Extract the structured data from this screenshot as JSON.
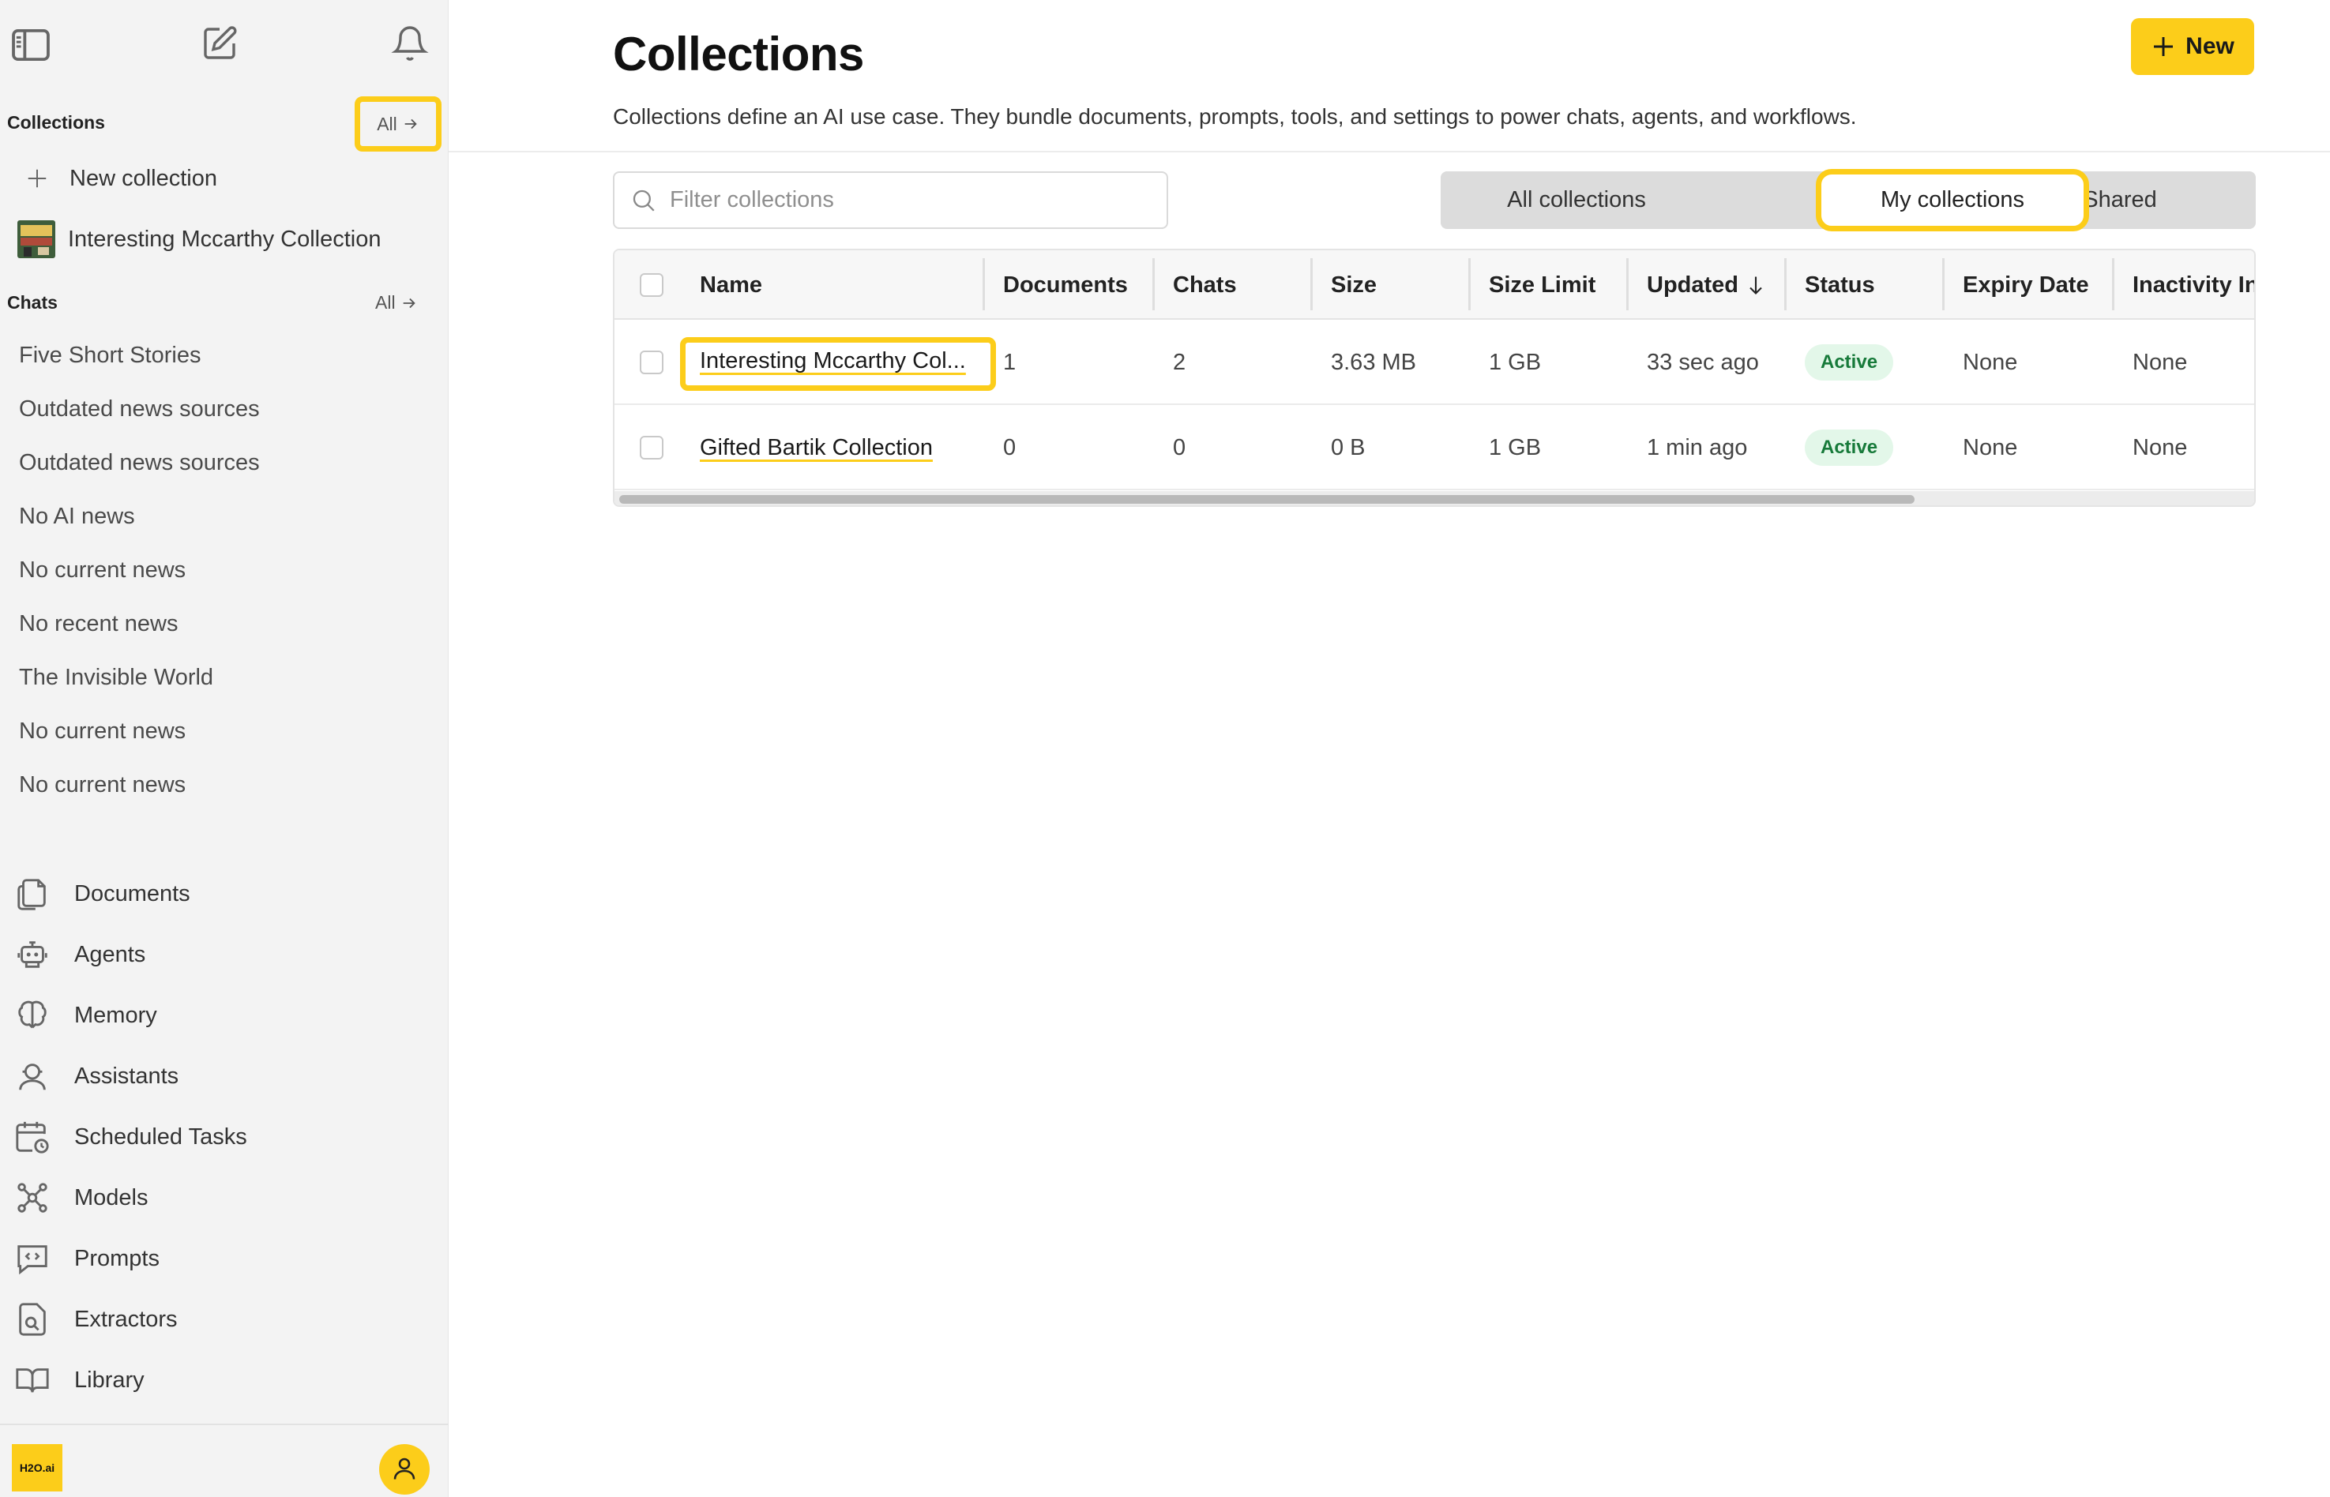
{
  "sidebar": {
    "collections_title": "Collections",
    "collections_all": "All",
    "new_collection": "New collection",
    "collection_item": "Interesting Mccarthy Collection",
    "chats_title": "Chats",
    "chats_all": "All",
    "chats": [
      "Five Short Stories",
      "Outdated news sources",
      "Outdated news sources",
      "No AI news",
      "No current news",
      "No recent news",
      "The Invisible World",
      "No current news",
      "No current news"
    ],
    "nav": [
      {
        "label": "Documents",
        "icon": "documents-icon"
      },
      {
        "label": "Agents",
        "icon": "robot-icon"
      },
      {
        "label": "Memory",
        "icon": "brain-icon"
      },
      {
        "label": "Assistants",
        "icon": "assistant-icon"
      },
      {
        "label": "Scheduled Tasks",
        "icon": "calendar-clock-icon"
      },
      {
        "label": "Models",
        "icon": "models-icon"
      },
      {
        "label": "Prompts",
        "icon": "prompt-code-icon"
      },
      {
        "label": "Extractors",
        "icon": "extractor-icon"
      },
      {
        "label": "Library",
        "icon": "book-icon"
      }
    ],
    "logo_text": "H2O.ai"
  },
  "header": {
    "title": "Collections",
    "subtitle": "Collections define an AI use case. They bundle documents, prompts, tools, and settings to power chats, agents, and workflows.",
    "new_button": "New"
  },
  "filter": {
    "placeholder": "Filter collections"
  },
  "tabs": {
    "all": "All collections",
    "mine": "My collections",
    "shared": "Shared",
    "selected": "My collections"
  },
  "table": {
    "columns": [
      "Name",
      "Documents",
      "Chats",
      "Size",
      "Size Limit",
      "Updated",
      "Status",
      "Expiry Date",
      "Inactivity In"
    ],
    "rows": [
      {
        "name": "Interesting Mccarthy Col...",
        "documents": "1",
        "chats": "2",
        "size": "3.63 MB",
        "size_limit": "1 GB",
        "updated": "33 sec ago",
        "status": "Active",
        "expiry": "None",
        "inactivity": "None"
      },
      {
        "name": "Gifted Bartik Collection",
        "documents": "0",
        "chats": "0",
        "size": "0 B",
        "size_limit": "1 GB",
        "updated": "1 min ago",
        "status": "Active",
        "expiry": "None",
        "inactivity": "None"
      }
    ]
  },
  "colors": {
    "accent": "#fccd1a",
    "status_bg": "#e3f7e9",
    "status_text": "#177a3a"
  }
}
